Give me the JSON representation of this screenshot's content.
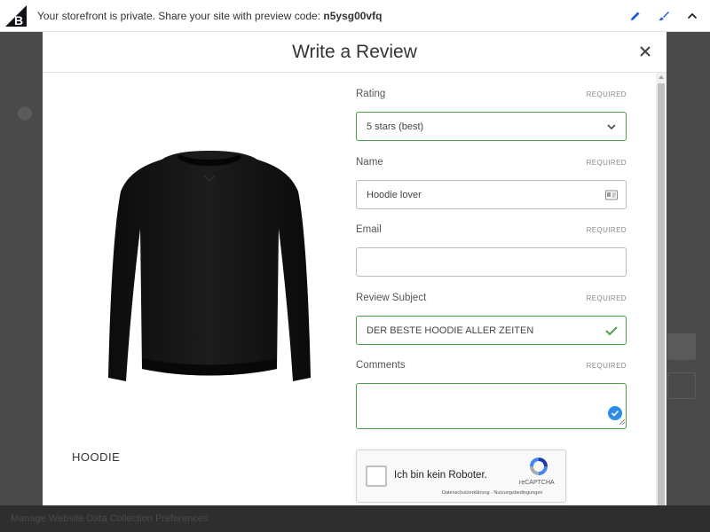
{
  "topbar": {
    "message": "Your storefront is private. Share your site with preview code: ",
    "preview_code": "n5ysg00vfq",
    "icons": [
      "pencil-icon",
      "brush-icon",
      "chevron-up-icon"
    ]
  },
  "footer": {
    "links": [
      "Manage Website Data Collection Preferences"
    ]
  },
  "modal": {
    "title": "Write a Review",
    "close_icon": "close-icon"
  },
  "product": {
    "name": "HOODIE"
  },
  "form": {
    "rating": {
      "label": "Rating",
      "required": "REQUIRED",
      "value": "5 stars (best)"
    },
    "name": {
      "label": "Name",
      "required": "REQUIRED",
      "value": "Hoodie lover"
    },
    "email": {
      "label": "Email",
      "required": "REQUIRED",
      "value": ""
    },
    "subject": {
      "label": "Review Subject",
      "required": "REQUIRED",
      "value": "DER BESTE HOODIE ALLER ZEITEN"
    },
    "comments": {
      "label": "Comments",
      "required": "REQUIRED",
      "value": ""
    }
  },
  "recaptcha": {
    "label": "Ich bin kein Roboter.",
    "brand": "reCAPTCHA",
    "links": "Datenschutzerklärung - Nutzungsbedingungen"
  },
  "colors": {
    "valid": "#4aa14a",
    "check_badge": "#2d8ce8",
    "edit_icon": "#1f5fd6"
  }
}
